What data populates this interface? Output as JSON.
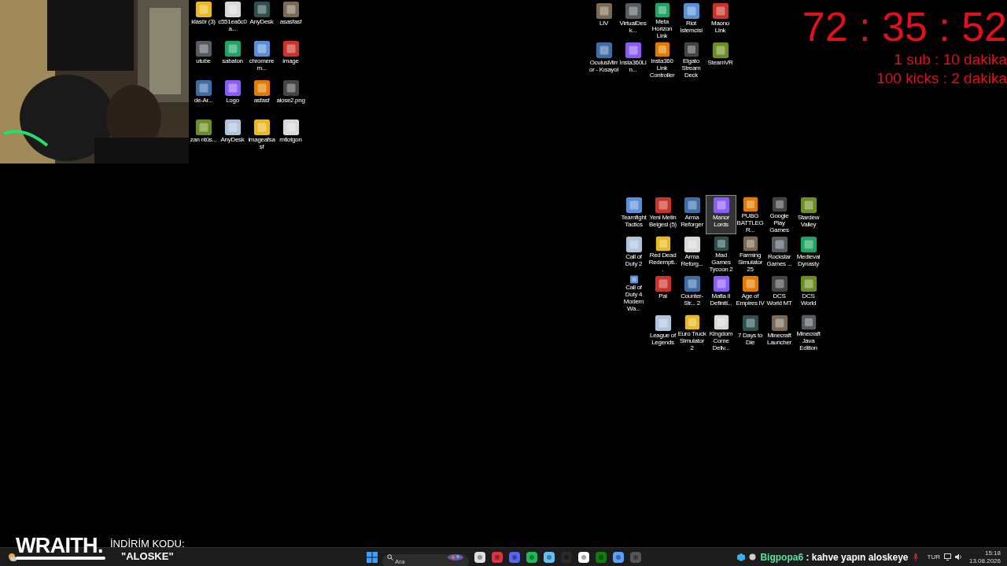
{
  "desktop_groups": [
    {
      "rows": [
        [
          {
            "label": "klasör (3)",
            "selected": false
          },
          {
            "label": "c551ea6c0a...",
            "selected": false
          },
          {
            "label": "AnyDesk",
            "selected": false
          },
          {
            "label": "asasfasf",
            "selected": false
          }
        ],
        [
          {
            "label": "utube",
            "selected": false
          },
          {
            "label": "sabaton",
            "selected": false
          },
          {
            "label": "chromerem...",
            "selected": false
          },
          {
            "label": "image",
            "selected": false
          }
        ],
        [
          {
            "label": "de-Ar...",
            "selected": false
          },
          {
            "label": "Logo",
            "selected": false
          },
          {
            "label": "asfasf",
            "selected": false
          },
          {
            "label": "alose2.png",
            "selected": false
          }
        ],
        [
          {
            "label": "zan ntüs...",
            "selected": false
          },
          {
            "label": "AnyDesk",
            "selected": false
          },
          {
            "label": "imageafsasf",
            "selected": false
          },
          {
            "label": "mtlotgon",
            "selected": false
          }
        ]
      ]
    },
    {
      "rows": [
        [
          {
            "label": "LIV",
            "selected": false
          },
          {
            "label": "VirtualDesk...",
            "selected": false
          },
          {
            "label": "Meta Horizon Link",
            "selected": false
          },
          {
            "label": "Riot İstemcisi",
            "selected": false
          },
          {
            "label": "Maono Link",
            "selected": false
          }
        ],
        [
          {
            "label": "OculusMirror - Kısayol",
            "selected": false
          },
          {
            "label": "Insta360Lin...",
            "selected": false
          },
          {
            "label": "Insta360 Link Controller",
            "selected": false
          },
          {
            "label": "Elgato Stream Deck",
            "selected": false
          },
          {
            "label": "SteamVR",
            "selected": false
          }
        ]
      ]
    },
    {
      "rows": [
        [
          {
            "label": "Teamfight Tactics",
            "selected": false
          },
          {
            "label": "Yeni Metin Belgesi (5)",
            "selected": false
          },
          {
            "label": "Arma Reforger",
            "selected": false
          },
          {
            "label": "Manor Lords",
            "selected": true
          },
          {
            "label": "PUBG BATTLEGR...",
            "selected": false
          },
          {
            "label": "Google Play Games",
            "selected": false
          },
          {
            "label": "Stardew Valley",
            "selected": false
          }
        ],
        [
          {
            "label": "Call of Duty 2",
            "selected": false
          },
          {
            "label": "Red Dead Redempti...",
            "selected": false
          },
          {
            "label": "Arma Reforg...",
            "selected": false
          },
          {
            "label": "Mad Games Tycoon 2",
            "selected": false
          },
          {
            "label": "Farming Simulator 25",
            "selected": false
          },
          {
            "label": "Rockstar Games ...",
            "selected": false
          },
          {
            "label": "Medieval Dynasty",
            "selected": false
          }
        ],
        [
          {
            "label": "Call of Duty 4 Modern Wa...",
            "selected": false
          },
          {
            "label": "Pal",
            "selected": false
          },
          {
            "label": "Counter-Str... 2",
            "selected": false
          },
          {
            "label": "Mafia II Definiti...",
            "selected": false
          },
          {
            "label": "Age of Empires IV",
            "selected": false
          },
          {
            "label": "DCS World MT",
            "selected": false
          },
          {
            "label": "DCS World",
            "selected": false
          }
        ],
        [
          "",
          {
            "label": "League of Legends",
            "selected": false
          },
          {
            "label": "Euro Truck Simulator 2",
            "selected": false
          },
          {
            "label": "Kingdom Come Deliv...",
            "selected": false
          },
          {
            "label": "7 Days to Die",
            "selected": false
          },
          {
            "label": "Minecraft Launcher",
            "selected": false
          },
          {
            "label": "Minecraft Java Edition",
            "selected": false
          }
        ]
      ]
    }
  ],
  "timer": {
    "time": "72 : 35 : 52",
    "rules": [
      "1 sub : 10 dakika",
      "100 kicks : 2 dakika"
    ]
  },
  "sponsor": {
    "brand": "WRAITH.",
    "code_label": "İNDİRİM KODU:",
    "code": "\"ALOSKE\""
  },
  "taskbar": {
    "search": {
      "placeholder": "Ara"
    },
    "chat": {
      "user": "Bigpopa6",
      "message": ": kahve yapın aloskeye"
    },
    "language": "TUR",
    "time": "15:18",
    "date": "13.08.2026"
  }
}
